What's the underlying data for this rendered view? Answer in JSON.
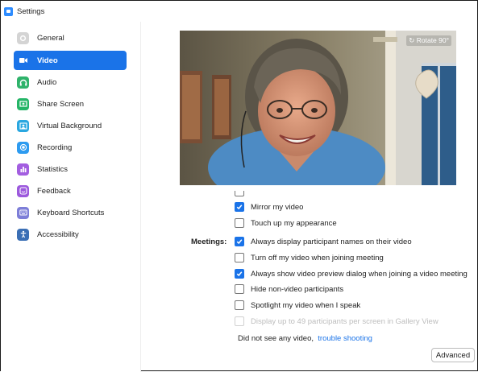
{
  "window": {
    "title": "Settings"
  },
  "sidebar": {
    "items": [
      {
        "label": "General",
        "icon": "gear-icon",
        "color": "#c9c9c9",
        "active": false
      },
      {
        "label": "Video",
        "icon": "video-camera-icon",
        "color": "#1a73e8",
        "active": true
      },
      {
        "label": "Audio",
        "icon": "headphones-icon",
        "color": "#2fb36b",
        "active": false
      },
      {
        "label": "Share Screen",
        "icon": "share-screen-icon",
        "color": "#25b567",
        "active": false
      },
      {
        "label": "Virtual Background",
        "icon": "virtual-background-icon",
        "color": "#2aa7e0",
        "active": false
      },
      {
        "label": "Recording",
        "icon": "record-icon",
        "color": "#2d9bf0",
        "active": false
      },
      {
        "label": "Statistics",
        "icon": "bar-chart-icon",
        "color": "#a35ee0",
        "active": false
      },
      {
        "label": "Feedback",
        "icon": "smiley-icon",
        "color": "#9c59dd",
        "active": false
      },
      {
        "label": "Keyboard Shortcuts",
        "icon": "keyboard-icon",
        "color": "#7d7ed8",
        "active": false
      },
      {
        "label": "Accessibility",
        "icon": "accessibility-icon",
        "color": "#3b6fb5",
        "active": false
      }
    ]
  },
  "video": {
    "rotate_label": "Rotate 90°"
  },
  "options": {
    "mirror": {
      "label": "Mirror my video",
      "checked": true
    },
    "touch_up": {
      "label": "Touch up my appearance",
      "checked": false
    }
  },
  "meetings": {
    "label": "Meetings:",
    "items": [
      {
        "label": "Always display participant names on their video",
        "checked": true,
        "disabled": false
      },
      {
        "label": "Turn off my video when joining meeting",
        "checked": false,
        "disabled": false
      },
      {
        "label": "Always show video preview dialog when joining a video meeting",
        "checked": true,
        "disabled": false
      },
      {
        "label": "Hide non-video participants",
        "checked": false,
        "disabled": false
      },
      {
        "label": "Spotlight my video when I speak",
        "checked": false,
        "disabled": false
      },
      {
        "label": "Display up to 49 participants per screen in Gallery View",
        "checked": false,
        "disabled": true
      }
    ]
  },
  "troubleshoot": {
    "text": "Did not see any video,",
    "link": "trouble shooting"
  },
  "advanced_button": "Advanced"
}
